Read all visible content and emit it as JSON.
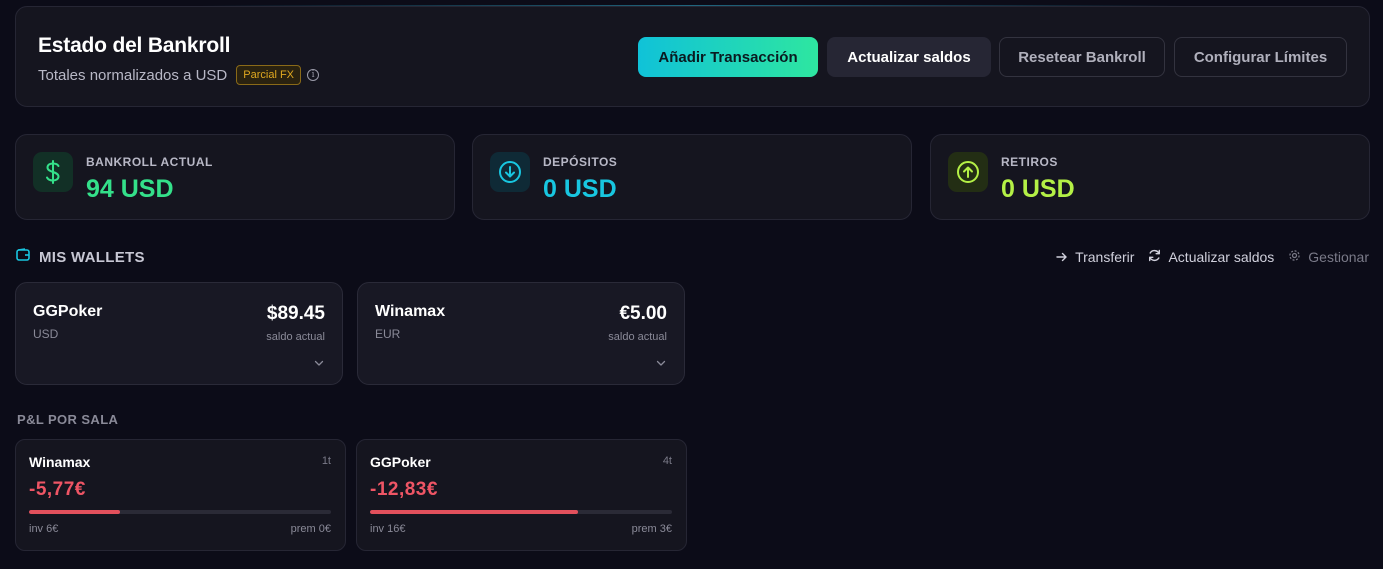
{
  "header": {
    "title": "Estado del Bankroll",
    "subtitle": "Totales normalizados a USD",
    "fx_badge": "Parcial FX",
    "info_icon": "info-icon",
    "buttons": {
      "add": "Añadir Transacción",
      "update": "Actualizar saldos",
      "reset": "Resetear Bankroll",
      "limits": "Configurar Límites"
    }
  },
  "stats": [
    {
      "label": "BANKROLL ACTUAL",
      "value": "94 USD",
      "icon": "dollar-icon",
      "color": "#34e08a"
    },
    {
      "label": "DEPÓSITOS",
      "value": "0 USD",
      "icon": "arrow-down-circle-icon",
      "color": "#18c6e0"
    },
    {
      "label": "RETIROS",
      "value": "0 USD",
      "icon": "arrow-up-circle-icon",
      "color": "#b4f046"
    }
  ],
  "wallets_section": {
    "title": "MIS WALLETS",
    "icon": "wallet-icon",
    "actions": {
      "transfer": "Transferir",
      "update": "Actualizar saldos",
      "manage": "Gestionar"
    }
  },
  "wallets": [
    {
      "name": "GGPoker",
      "currency": "USD",
      "balance": "$89.45",
      "balance_label": "saldo actual"
    },
    {
      "name": "Winamax",
      "currency": "EUR",
      "balance": "€5.00",
      "balance_label": "saldo actual"
    }
  ],
  "pl_section": {
    "title": "P&L POR SALA"
  },
  "pl_rooms": [
    {
      "name": "Winamax",
      "count": "1t",
      "value": "-5,77€",
      "progress": 0.3,
      "invested": "inv 6€",
      "prizes": "prem 0€"
    },
    {
      "name": "GGPoker",
      "count": "4t",
      "value": "-12,83€",
      "progress": 0.69,
      "invested": "inv 16€",
      "prizes": "prem 3€"
    }
  ],
  "colors": {
    "accent_start": "#10c2d8",
    "accent_end": "#2ee6a0",
    "negative": "#ef5565",
    "badge": "#e0a820"
  }
}
